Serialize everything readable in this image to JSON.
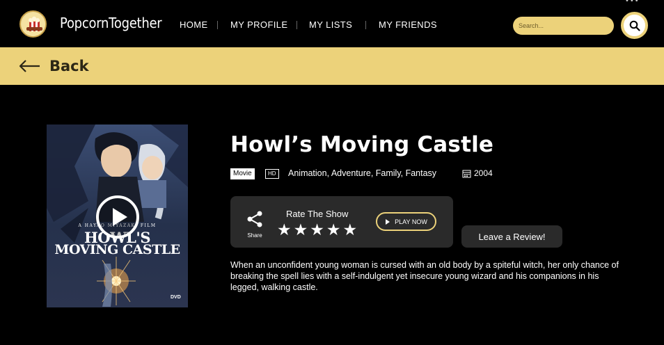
{
  "app": {
    "brand": "PopcornTogether"
  },
  "nav": {
    "items": [
      {
        "label": "HOME"
      },
      {
        "label": "MY PROFILE"
      },
      {
        "label": "MY LISTS"
      },
      {
        "label": "MY FRIENDS"
      }
    ]
  },
  "search": {
    "placeholder": "Search...",
    "icon": "search-icon"
  },
  "back": {
    "label": "Back",
    "icon": "arrow-left-icon"
  },
  "poster": {
    "credit": "A HAYAO MIYAZAKI FILM",
    "title_line1": "HOWL'S",
    "title_line2": "MOVING CASTLE",
    "rating": "DVD"
  },
  "movie": {
    "title": "Howl’s Moving Castle",
    "type_badge": "Movie",
    "quality_badge": "HD",
    "genres": "Animation, Adventure, Family, Fantasy",
    "year": "2004",
    "description": "When an unconfident young woman is cursed with an old body by a spiteful witch, her only chance of breaking the spell lies with a self-indulgent yet insecure young wizard and his companions in his legged, walking castle."
  },
  "actions": {
    "share_label": "Share",
    "rate_label": "Rate The Show",
    "stars": [
      "★",
      "★",
      "★",
      "★",
      "★"
    ],
    "play_now_label": "PLAY NOW",
    "review_label": "Leave a Review!"
  },
  "colors": {
    "accent": "#ecd27a",
    "background": "#000000",
    "card": "#2a2a2a"
  }
}
